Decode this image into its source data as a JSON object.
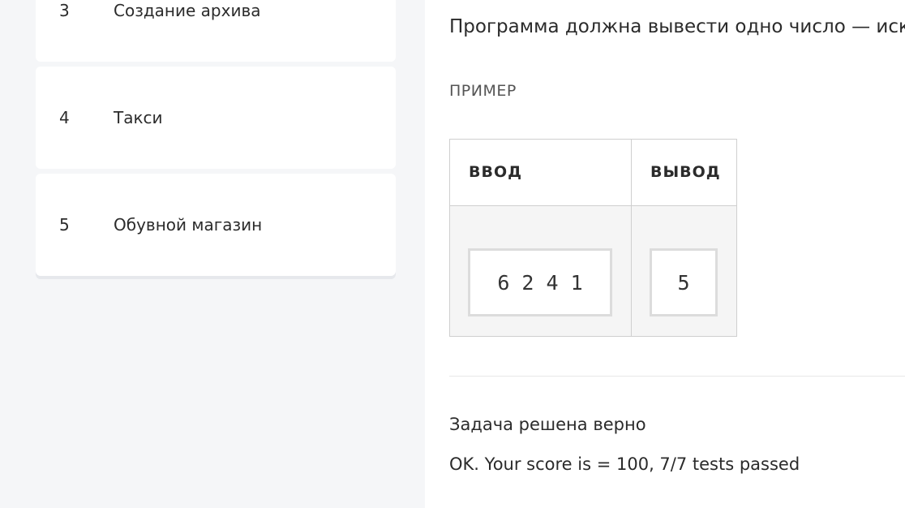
{
  "sidebar": {
    "tasks": [
      {
        "number": "3",
        "title": "Создание архива"
      },
      {
        "number": "4",
        "title": "Такси"
      },
      {
        "number": "5",
        "title": "Обувной магазин"
      }
    ]
  },
  "problem": {
    "output_description": "Программа должна вывести одно число — иско",
    "example_label": "ПРИМЕР",
    "example": {
      "input_header": "ВВОД",
      "output_header": "ВЫВОД",
      "input_value": "6 2 4 1",
      "output_value": "5"
    }
  },
  "result": {
    "status": "Задача решена верно",
    "details": "OK. Your score is = 100, 7/7 tests passed"
  }
}
